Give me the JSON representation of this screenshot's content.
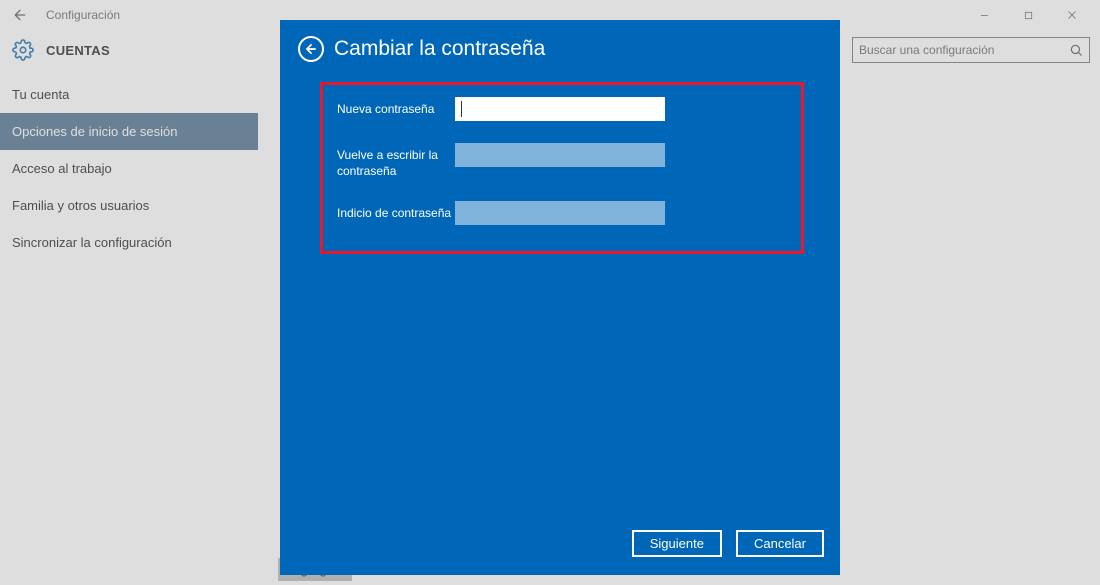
{
  "window": {
    "title": "Configuración"
  },
  "header": {
    "section": "CUENTAS"
  },
  "search": {
    "placeholder": "Buscar una configuración"
  },
  "sidebar": {
    "items": [
      "Tu cuenta",
      "Opciones de inicio de sesión",
      "Acceso al trabajo",
      "Familia y otros usuarios",
      "Sincronizar la configuración"
    ],
    "selected_index": 1
  },
  "content": {
    "button_label": "Agregar"
  },
  "dialog": {
    "title": "Cambiar la contraseña",
    "fields": {
      "new_password": "Nueva contraseña",
      "repeat_password": "Vuelve a escribir la contraseña",
      "hint": "Indicio de contraseña"
    },
    "primary": "Siguiente",
    "secondary": "Cancelar"
  }
}
